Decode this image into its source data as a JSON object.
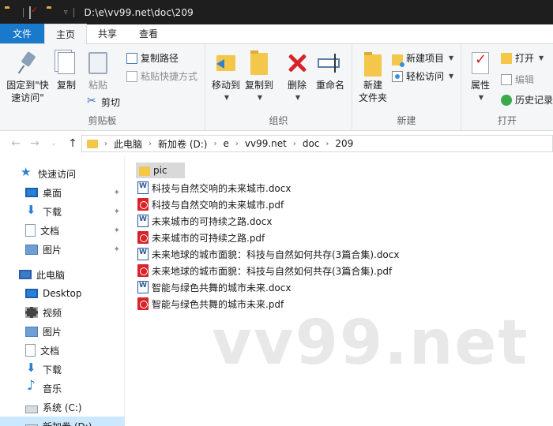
{
  "window": {
    "title_path": "D:\\e\\vv99.net\\doc\\209"
  },
  "tabs": [
    {
      "label": "文件"
    },
    {
      "label": "主页"
    },
    {
      "label": "共享"
    },
    {
      "label": "查看"
    }
  ],
  "ribbon": {
    "clipboard": {
      "pin_label": "固定到\"快速访问\"",
      "copy_label": "复制",
      "paste_label": "粘贴",
      "copy_path_label": "复制路径",
      "paste_shortcut_label": "粘贴快捷方式",
      "cut_label": "剪切",
      "group_label": "剪贴板"
    },
    "organize": {
      "move_to_label": "移动到",
      "copy_to_label": "复制到",
      "delete_label": "删除",
      "rename_label": "重命名",
      "group_label": "组织"
    },
    "new": {
      "new_folder_label": "新建\n文件夹",
      "new_item_label": "新建项目",
      "easy_access_label": "轻松访问",
      "group_label": "新建"
    },
    "open": {
      "properties_label": "属性",
      "open_label": "打开",
      "edit_label": "编辑",
      "history_label": "历史记录",
      "group_label": "打开"
    }
  },
  "address": {
    "crumbs": [
      "此电脑",
      "新加卷 (D:)",
      "e",
      "vv99.net",
      "doc",
      "209"
    ]
  },
  "sidebar": {
    "quick_access": "快速访问",
    "quick_items": [
      "桌面",
      "下载",
      "文档",
      "图片"
    ],
    "this_pc": "此电脑",
    "pc_items": [
      "Desktop",
      "视频",
      "图片",
      "文档",
      "下载",
      "音乐",
      "系统 (C:)",
      "新加卷 (D:)"
    ]
  },
  "files": [
    {
      "name": "pic",
      "type": "folder"
    },
    {
      "name": "科技与自然交响的未来城市.docx",
      "type": "word"
    },
    {
      "name": "科技与自然交响的未来城市.pdf",
      "type": "pdf"
    },
    {
      "name": "未来城市的可持续之路.docx",
      "type": "word"
    },
    {
      "name": "未来城市的可持续之路.pdf",
      "type": "pdf"
    },
    {
      "name": "未来地球的城市面貌：科技与自然如何共存(3篇合集).docx",
      "type": "word"
    },
    {
      "name": "未来地球的城市面貌：科技与自然如何共存(3篇合集).pdf",
      "type": "pdf"
    },
    {
      "name": "智能与绿色共舞的城市未来.docx",
      "type": "word"
    },
    {
      "name": "智能与绿色共舞的城市未来.pdf",
      "type": "pdf"
    }
  ],
  "watermark": "vv99.net"
}
